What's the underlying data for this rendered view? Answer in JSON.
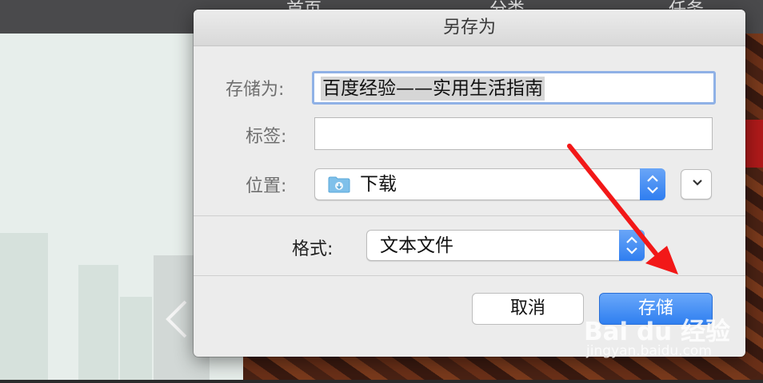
{
  "background": {
    "nav_items": [
      "首页",
      "分类 ⌄",
      "任务 ⌄"
    ]
  },
  "dialog": {
    "title": "另存为",
    "save_as": {
      "label": "存储为:",
      "value": "百度经验——实用生活指南"
    },
    "tags": {
      "label": "标签:",
      "value": ""
    },
    "location": {
      "label": "位置:",
      "value": "下载"
    },
    "format": {
      "label": "格式:",
      "value": "文本文件"
    },
    "buttons": {
      "cancel": "取消",
      "save": "存储"
    }
  },
  "watermark": {
    "logo": "Bai du 经验",
    "url": "jingyan.baidu.com"
  },
  "colors": {
    "accent": "#3a84f2",
    "arrow": "#f21818",
    "focus_ring": "#8fb1e6"
  }
}
